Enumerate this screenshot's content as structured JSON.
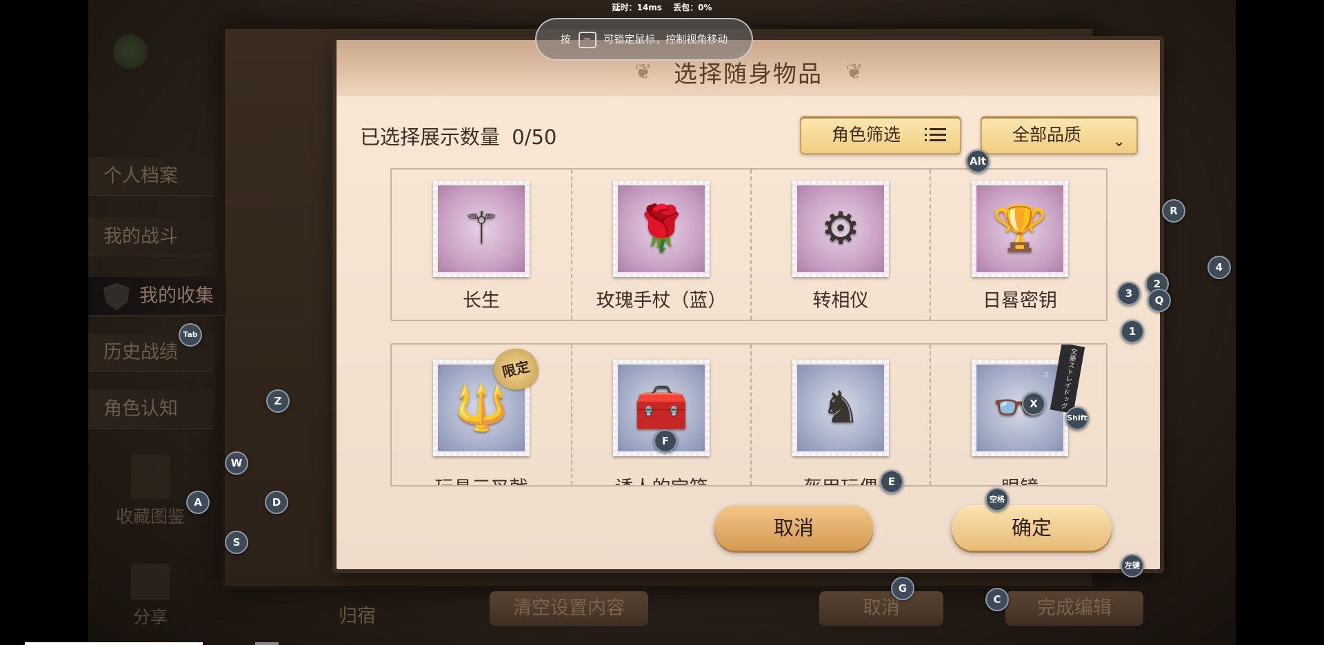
{
  "overlay": {
    "latency": "延时：14ms",
    "packet_loss": "丢包：0%",
    "lock_hint_prefix": "按",
    "lock_hint_key": "~",
    "lock_hint_text": "可锁定鼠标，控制视角移动"
  },
  "sidebar": {
    "items": [
      {
        "label": "个人档案"
      },
      {
        "label": "我的战斗"
      },
      {
        "label": "我的收集"
      },
      {
        "label": "历史战绩"
      },
      {
        "label": "角色认知"
      }
    ],
    "album": "收藏图鉴",
    "share": "分享"
  },
  "bottom_bar": {
    "archive": "归宿",
    "clear": "清空设置内容",
    "cancel": "取消",
    "finish": "完成编辑"
  },
  "dialog": {
    "title": "选择随身物品",
    "count_label": "已选择展示数量",
    "count_value": "0/50",
    "role_filter": "角色筛选",
    "quality_filter": "全部品质",
    "cancel": "取消",
    "confirm": "确定",
    "rows": [
      {
        "items": [
          {
            "name": "长生",
            "frame": "pink",
            "glyph": "⚚"
          },
          {
            "name": "玫瑰手杖（蓝）",
            "frame": "pink",
            "glyph": "🌹"
          },
          {
            "name": "转相仪",
            "frame": "pink",
            "glyph": "⚙"
          },
          {
            "name": "日晷密钥",
            "frame": "pink",
            "glyph": "🏆"
          }
        ]
      },
      {
        "items": [
          {
            "name": "玩具三叉戟",
            "frame": "blue",
            "glyph": "🔱",
            "badge": "限定"
          },
          {
            "name": "诱人的宝箱",
            "frame": "blue",
            "glyph": "🧰"
          },
          {
            "name": "盔甲玩偶",
            "frame": "blue",
            "glyph": "♞"
          },
          {
            "name": "眼镜",
            "frame": "blue",
            "glyph": "👓",
            "ribbon": "文豪ストレイドッグス"
          }
        ]
      }
    ]
  },
  "key_hints": [
    "Alt",
    "R",
    "2",
    "4",
    "3",
    "Q",
    "1",
    "Tab",
    "Z",
    "X",
    "Shift",
    "F",
    "W",
    "A",
    "D",
    "E",
    "空格",
    "S",
    "左键",
    "G",
    "C"
  ]
}
